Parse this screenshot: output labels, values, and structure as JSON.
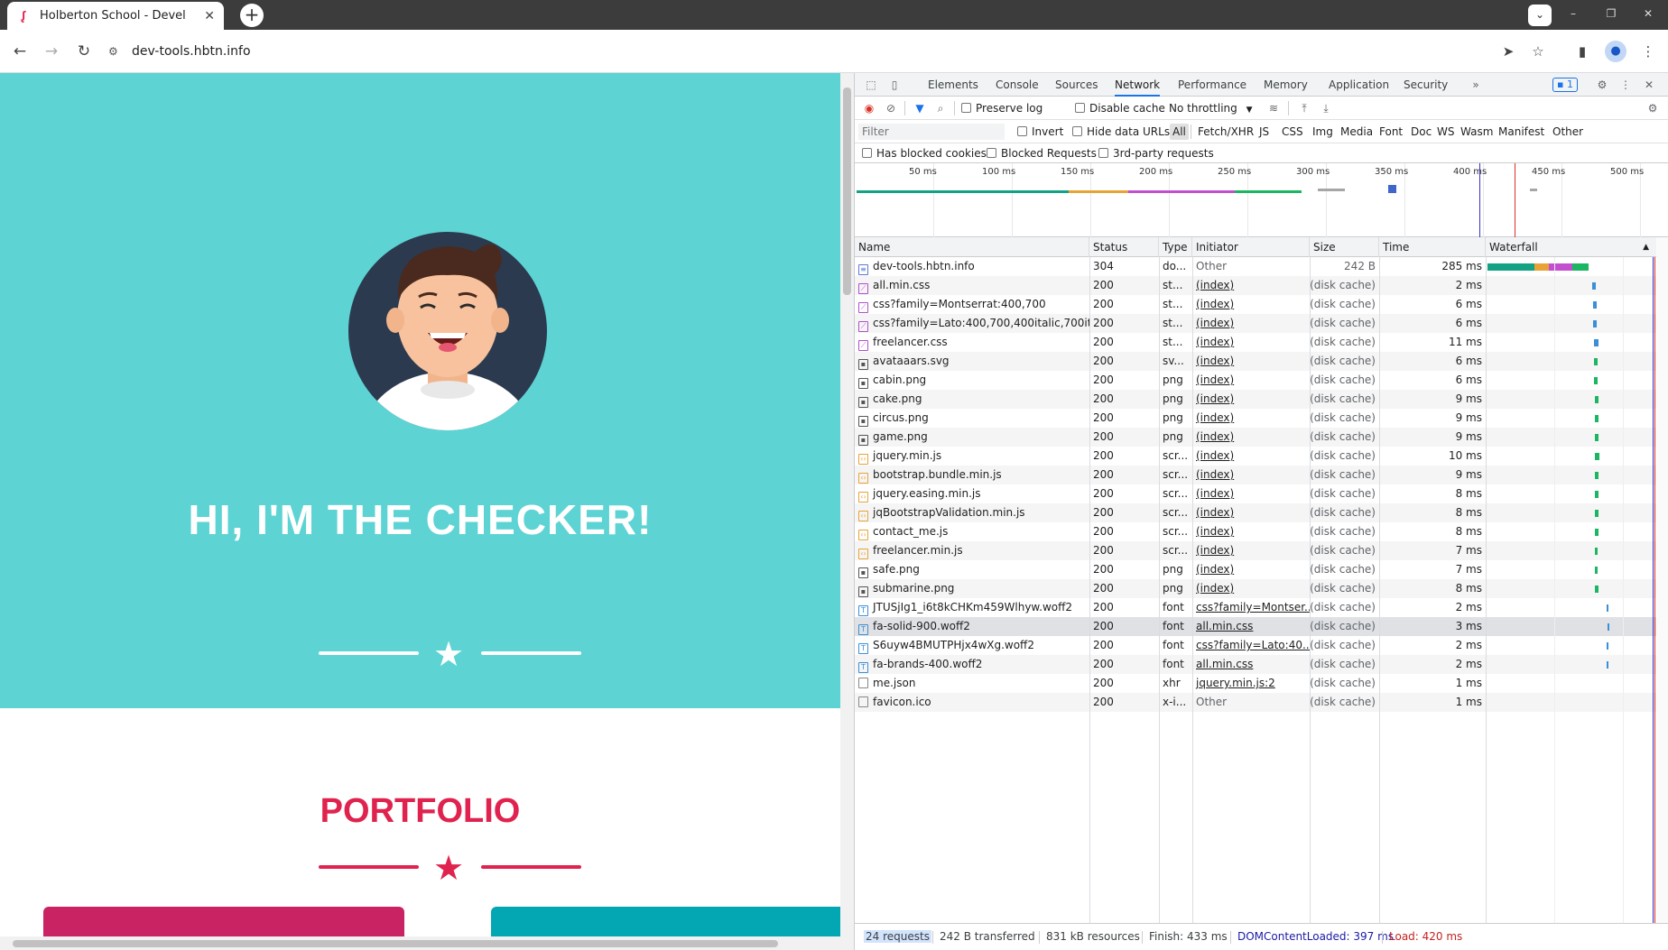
{
  "browser": {
    "tab_title": "Holberton School - Devel",
    "url": "dev-tools.hbtn.info"
  },
  "page": {
    "masthead_title": "HI, I'M THE CHECKER!",
    "portfolio_title": "PORTFOLIO",
    "colors": {
      "masthead": "#5dd3d3",
      "accent": "#e0234e",
      "card1": "#c92363",
      "card2": "#03a6b3"
    }
  },
  "devtools": {
    "tabs": [
      "Elements",
      "Console",
      "Sources",
      "Network",
      "Performance",
      "Memory",
      "Application",
      "Security"
    ],
    "active_tab": "Network",
    "issues_badge": "1",
    "toolbar": {
      "preserve_log": "Preserve log",
      "disable_cache": "Disable cache",
      "throttling": "No throttling",
      "filter_placeholder": "Filter",
      "invert": "Invert",
      "hide_data_urls": "Hide data URLs",
      "filter_types": [
        "All",
        "Fetch/XHR",
        "JS",
        "CSS",
        "Img",
        "Media",
        "Font",
        "Doc",
        "WS",
        "Wasm",
        "Manifest",
        "Other"
      ],
      "active_filter": "All",
      "has_blocked_cookies": "Has blocked cookies",
      "blocked_requests": "Blocked Requests",
      "third_party": "3rd-party requests"
    },
    "overview_ticks": [
      "50 ms",
      "100 ms",
      "150 ms",
      "200 ms",
      "250 ms",
      "300 ms",
      "350 ms",
      "400 ms",
      "450 ms",
      "500 ms"
    ],
    "columns": [
      "Name",
      "Status",
      "Type",
      "Initiator",
      "Size",
      "Time",
      "Waterfall"
    ],
    "requests": [
      {
        "name": "dev-tools.hbtn.info",
        "status": "304",
        "type": "do...",
        "initiator": "Other",
        "size": "242 B",
        "time": "285 ms",
        "icon": "doc"
      },
      {
        "name": "all.min.css",
        "status": "200",
        "type": "st...",
        "initiator": "(index)",
        "size": "(disk cache)",
        "time": "2 ms",
        "icon": "css"
      },
      {
        "name": "css?family=Montserrat:400,700",
        "status": "200",
        "type": "st...",
        "initiator": "(index)",
        "size": "(disk cache)",
        "time": "6 ms",
        "icon": "css"
      },
      {
        "name": "css?family=Lato:400,700,400italic,700italic",
        "status": "200",
        "type": "st...",
        "initiator": "(index)",
        "size": "(disk cache)",
        "time": "6 ms",
        "icon": "css"
      },
      {
        "name": "freelancer.css",
        "status": "200",
        "type": "st...",
        "initiator": "(index)",
        "size": "(disk cache)",
        "time": "11 ms",
        "icon": "css"
      },
      {
        "name": "avataaars.svg",
        "status": "200",
        "type": "sv...",
        "initiator": "(index)",
        "size": "(disk cache)",
        "time": "6 ms",
        "icon": "img"
      },
      {
        "name": "cabin.png",
        "status": "200",
        "type": "png",
        "initiator": "(index)",
        "size": "(disk cache)",
        "time": "6 ms",
        "icon": "img"
      },
      {
        "name": "cake.png",
        "status": "200",
        "type": "png",
        "initiator": "(index)",
        "size": "(disk cache)",
        "time": "9 ms",
        "icon": "img"
      },
      {
        "name": "circus.png",
        "status": "200",
        "type": "png",
        "initiator": "(index)",
        "size": "(disk cache)",
        "time": "9 ms",
        "icon": "img"
      },
      {
        "name": "game.png",
        "status": "200",
        "type": "png",
        "initiator": "(index)",
        "size": "(disk cache)",
        "time": "9 ms",
        "icon": "img"
      },
      {
        "name": "jquery.min.js",
        "status": "200",
        "type": "scr...",
        "initiator": "(index)",
        "size": "(disk cache)",
        "time": "10 ms",
        "icon": "js"
      },
      {
        "name": "bootstrap.bundle.min.js",
        "status": "200",
        "type": "scr...",
        "initiator": "(index)",
        "size": "(disk cache)",
        "time": "9 ms",
        "icon": "js"
      },
      {
        "name": "jquery.easing.min.js",
        "status": "200",
        "type": "scr...",
        "initiator": "(index)",
        "size": "(disk cache)",
        "time": "8 ms",
        "icon": "js"
      },
      {
        "name": "jqBootstrapValidation.min.js",
        "status": "200",
        "type": "scr...",
        "initiator": "(index)",
        "size": "(disk cache)",
        "time": "8 ms",
        "icon": "js"
      },
      {
        "name": "contact_me.js",
        "status": "200",
        "type": "scr...",
        "initiator": "(index)",
        "size": "(disk cache)",
        "time": "8 ms",
        "icon": "js"
      },
      {
        "name": "freelancer.min.js",
        "status": "200",
        "type": "scr...",
        "initiator": "(index)",
        "size": "(disk cache)",
        "time": "7 ms",
        "icon": "js"
      },
      {
        "name": "safe.png",
        "status": "200",
        "type": "png",
        "initiator": "(index)",
        "size": "(disk cache)",
        "time": "7 ms",
        "icon": "img"
      },
      {
        "name": "submarine.png",
        "status": "200",
        "type": "png",
        "initiator": "(index)",
        "size": "(disk cache)",
        "time": "8 ms",
        "icon": "img"
      },
      {
        "name": "JTUSjIg1_i6t8kCHKm459Wlhyw.woff2",
        "status": "200",
        "type": "font",
        "initiator": "css?family=Montser...",
        "size": "(disk cache)",
        "time": "2 ms",
        "icon": "font"
      },
      {
        "name": "fa-solid-900.woff2",
        "status": "200",
        "type": "font",
        "initiator": "all.min.css",
        "size": "(disk cache)",
        "time": "3 ms",
        "icon": "font"
      },
      {
        "name": "S6uyw4BMUTPHjx4wXg.woff2",
        "status": "200",
        "type": "font",
        "initiator": "css?family=Lato:40...",
        "size": "(disk cache)",
        "time": "2 ms",
        "icon": "font"
      },
      {
        "name": "fa-brands-400.woff2",
        "status": "200",
        "type": "font",
        "initiator": "all.min.css",
        "size": "(disk cache)",
        "time": "2 ms",
        "icon": "font"
      },
      {
        "name": "me.json",
        "status": "200",
        "type": "xhr",
        "initiator": "jquery.min.js:2",
        "size": "(disk cache)",
        "time": "1 ms",
        "icon": "other"
      },
      {
        "name": "favicon.ico",
        "status": "200",
        "type": "x-i...",
        "initiator": "Other",
        "size": "(disk cache)",
        "time": "1 ms",
        "icon": "other"
      }
    ],
    "status_bar": {
      "requests": "24 requests",
      "transferred": "242 B transferred",
      "resources": "831 kB resources",
      "finish": "Finish: 433 ms",
      "dom_content_loaded": "DOMContentLoaded: 397 ms",
      "load": "Load: 420 ms"
    }
  }
}
